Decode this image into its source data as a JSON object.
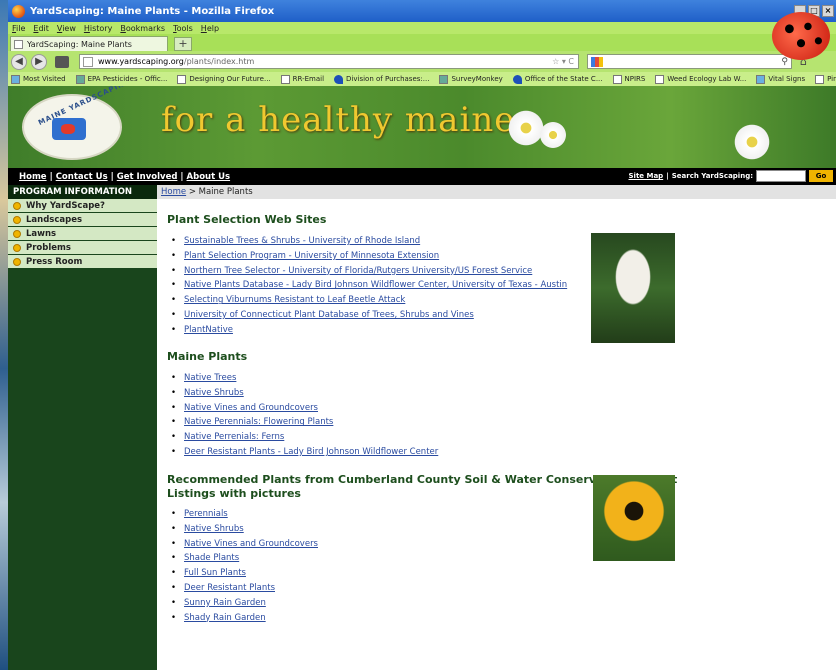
{
  "window": {
    "title": "YardScaping: Maine Plants - Mozilla Firefox",
    "buttons": [
      "_",
      "□",
      "×"
    ]
  },
  "menu": [
    "File",
    "Edit",
    "View",
    "History",
    "Bookmarks",
    "Tools",
    "Help"
  ],
  "tab": {
    "label": "YardScaping: Maine Plants",
    "new_tab": "+"
  },
  "nav": {
    "url_host": "www.yardscaping.org",
    "url_path": "/plants/index.htm",
    "url_controls": "☆ ▾ C",
    "search_icon": "magnifier-icon"
  },
  "bookmarks": [
    "Most Visited",
    "EPA Pesticides - Offic...",
    "Designing Our Future...",
    "RR-Email",
    "Division of Purchases:...",
    "SurveyMonkey",
    "Office of the State C...",
    "NPIRS",
    "Weed Ecology Lab W...",
    "Vital Signs",
    "Pine Pest Partners S"
  ],
  "banner": {
    "tagline": "for a healthy maine",
    "logo_text": "MAINE YARDSCAPING"
  },
  "topnav": {
    "links": [
      "Home",
      "Contact Us",
      "Get Involved",
      "About Us"
    ],
    "sitemap": "Site Map",
    "search_label": "Search YardScaping:",
    "go": "Go"
  },
  "sidebar": {
    "heading": "PROGRAM INFORMATION",
    "items": [
      "Why YardScape?",
      "Landscapes",
      "Lawns",
      "Problems",
      "Press Room"
    ]
  },
  "breadcrumb": {
    "home": "Home",
    "current": "> Maine Plants"
  },
  "sections": [
    {
      "title": "Plant Selection Web Sites",
      "links": [
        "Sustainable Trees & Shrubs - University of Rhode Island",
        "Plant Selection Program - University of Minnesota Extension",
        "Northern Tree Selector - University of Florida/Rutgers University/US Forest Service",
        "Native Plants Database - Lady Bird Johnson Wildflower Center, University of Texas - Austin",
        "Selecting Viburnums Resistant to Leaf Beetle Attack",
        "University of Connecticut Plant Database of Trees, Shrubs and Vines",
        "PlantNative"
      ]
    },
    {
      "title": "Maine Plants",
      "links": [
        "Native Trees",
        "Native Shrubs",
        "Native Vines and Groundcovers",
        "Native Perennials: Flowering Plants",
        "Native Perrenials: Ferns",
        "Deer Resistant Plants - Lady Bird Johnson Wildflower Center"
      ]
    },
    {
      "title": "Recommended Plants from Cumberland County Soil & Water Conservation District Listings with pictures",
      "links": [
        "Perennials",
        "Native Shrubs",
        "Native Vines and Groundcovers",
        "Shade Plants",
        "Full Sun Plants",
        "Deer Resistant Plants",
        "Sunny Rain Garden",
        "Shady Rain Garden"
      ]
    }
  ]
}
